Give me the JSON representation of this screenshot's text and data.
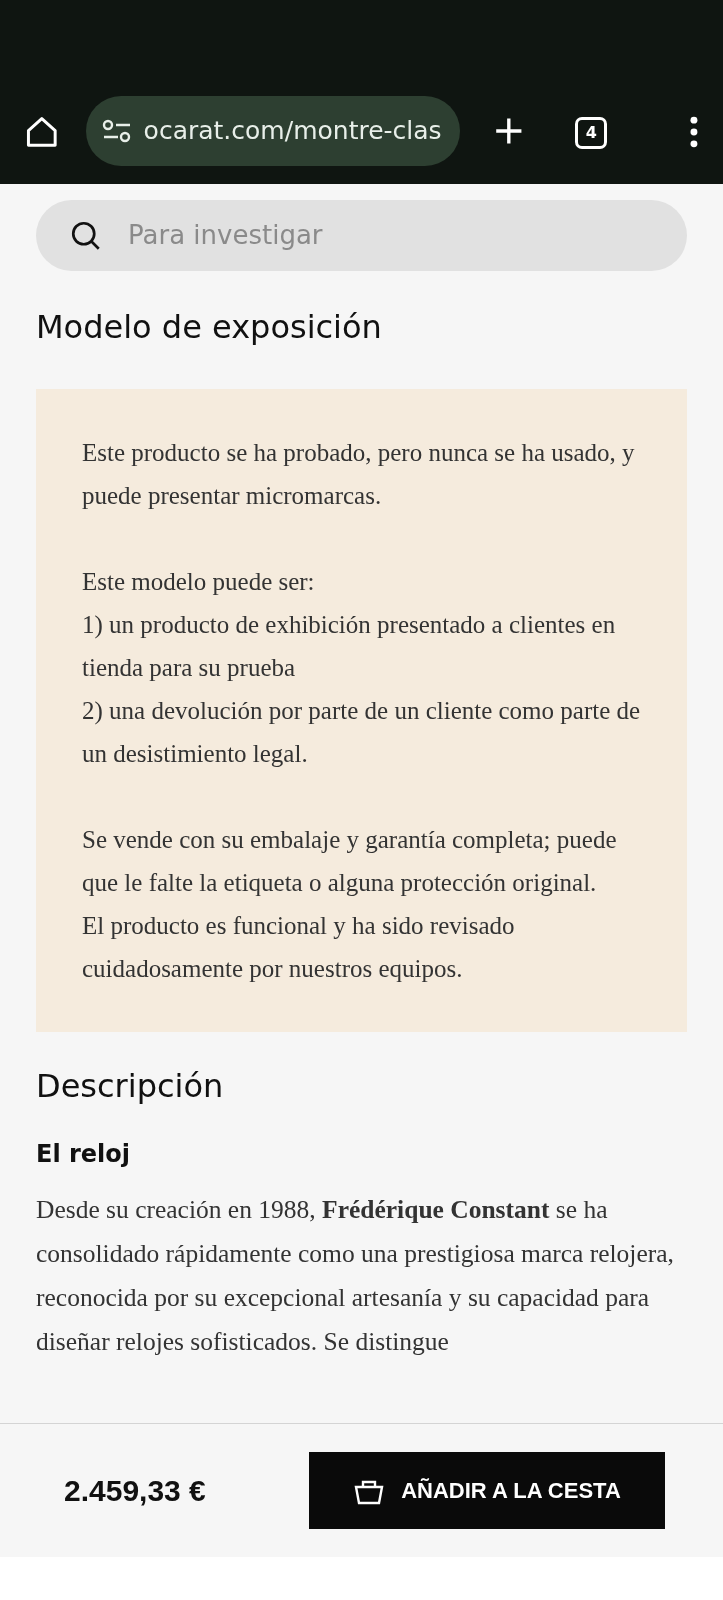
{
  "browser": {
    "url": "ocarat.com/montre-clas",
    "tab_count": "4"
  },
  "search": {
    "placeholder": "Para investigar"
  },
  "condition": {
    "title": "Modelo de exposición",
    "blocks": [
      [
        "Este producto se ha probado, pero nunca se ha usado, y puede presentar micromarcas."
      ],
      [
        "Este modelo puede ser:",
        "1) un producto de exhibición presentado a clientes en tienda para su prueba",
        "2) una devolución por parte de un cliente como parte de un desistimiento legal."
      ],
      [
        "Se vende con su embalaje y garantía completa; puede que le falte la etiqueta o alguna protección original.",
        "El producto es funcional y ha sido revisado cuidadosamente por nuestros equipos."
      ]
    ]
  },
  "description": {
    "title": "Descripción",
    "subtitle": "El reloj",
    "text": "Desde su creación en 1988, **Frédérique Constant** se ha consolidado rápidamente como una prestigiosa marca relojera, reconocida por su excepcional artesanía y su capacidad para diseñar relojes sofisticados. Se distingue"
  },
  "purchase_bar": {
    "price": "2.459,33 €",
    "button": "AÑADIR A LA CESTA"
  }
}
